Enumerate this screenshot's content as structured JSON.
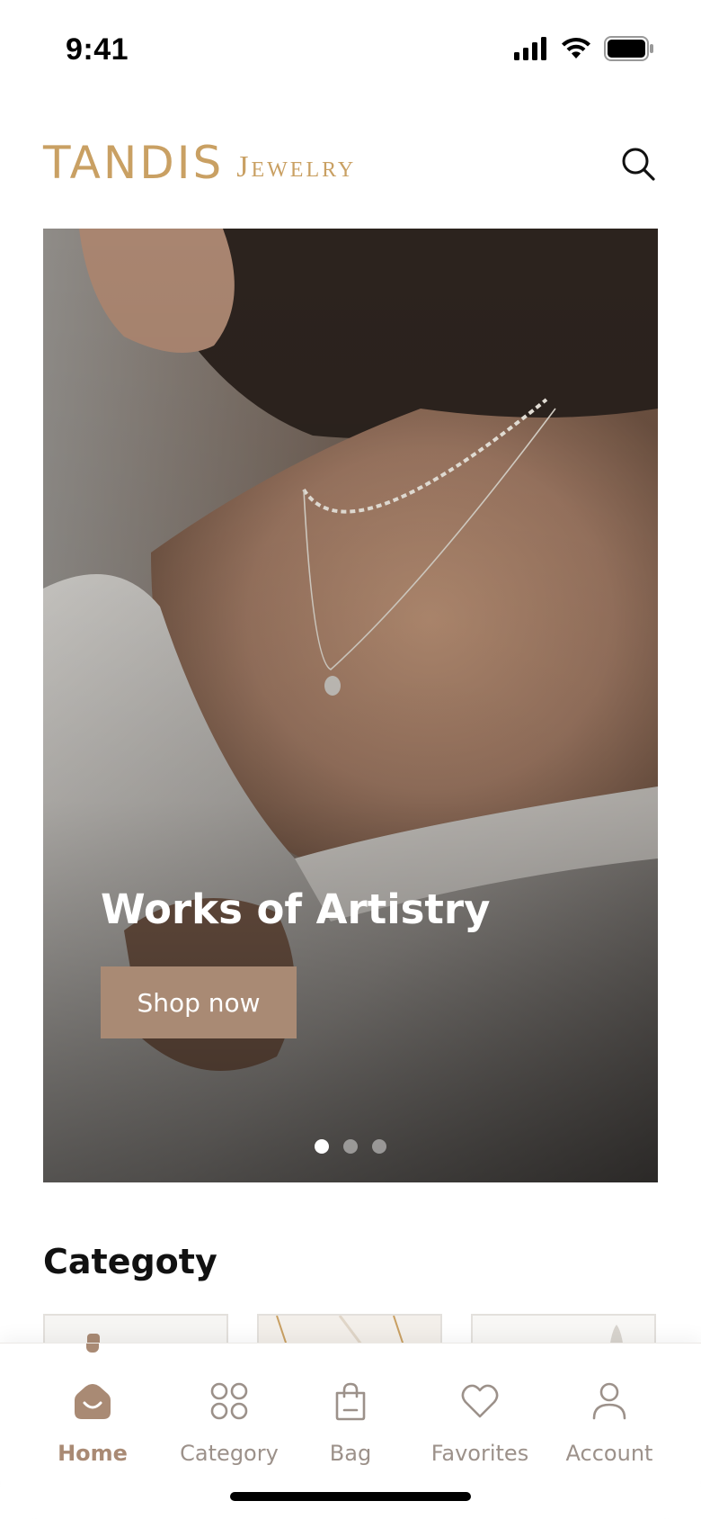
{
  "status_bar": {
    "time": "9:41"
  },
  "header": {
    "brand_main": "TANDIS",
    "brand_sub": "Jewelry",
    "search_icon": "search-icon"
  },
  "hero": {
    "title": "Works of Artistry",
    "button_label": "Shop now",
    "slide_count": 3,
    "active_slide": 1
  },
  "category": {
    "title": "Categoty"
  },
  "bottom_nav": {
    "items": [
      {
        "label": "Home",
        "icon": "home-icon",
        "active": true
      },
      {
        "label": "Category",
        "icon": "grid-icon",
        "active": false
      },
      {
        "label": "Bag",
        "icon": "bag-icon",
        "active": false
      },
      {
        "label": "Favorites",
        "icon": "heart-icon",
        "active": false
      },
      {
        "label": "Account",
        "icon": "user-icon",
        "active": false
      }
    ]
  },
  "colors": {
    "brand_gold": "#c9a063",
    "accent_taupe": "#a98a74",
    "nav_inactive": "#9c918a"
  }
}
